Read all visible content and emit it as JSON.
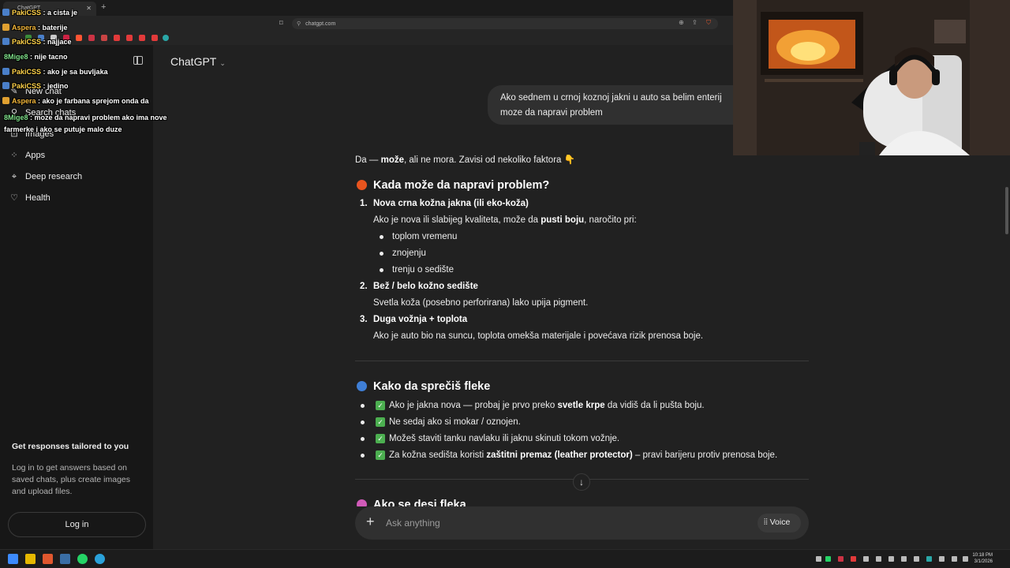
{
  "browser": {
    "tab_title": "ChatGPT",
    "url": "chatgpt.com"
  },
  "sidebar": {
    "items": [
      {
        "label": "New chat",
        "icon": "edit-icon"
      },
      {
        "label": "Search chats",
        "icon": "search-icon"
      },
      {
        "label": "Images",
        "icon": "image-icon"
      },
      {
        "label": "Apps",
        "icon": "apps-icon"
      },
      {
        "label": "Deep research",
        "icon": "telescope-icon"
      },
      {
        "label": "Health",
        "icon": "heart-icon"
      }
    ],
    "promo_title": "Get responses tailored to you",
    "promo_text": "Log in to get answers based on saved chats, plus create images and upload files.",
    "login_label": "Log in"
  },
  "stream_chat": [
    {
      "user": "PakiCSS",
      "message": "a cista je"
    },
    {
      "user": "Aspera",
      "message": "baterije"
    },
    {
      "user": "PakiCSS",
      "message": "najjace"
    },
    {
      "user": "8Mige8",
      "message": "nije tacno"
    },
    {
      "user": "PakiCSS",
      "message": "ako je sa buvljaka"
    },
    {
      "user": "PakiCSS",
      "message": "jedino"
    },
    {
      "user": "Aspera",
      "message": "ako je farbana sprejom onda da"
    },
    {
      "user": "8Mige8",
      "message": "moze da napravi problem ako ima nove farmerke i ako se putuje malo duze"
    }
  ],
  "header": {
    "model_name": "ChatGPT"
  },
  "conversation": {
    "user_message_line1": "Ako sednem u crnoj koznoj jakni u auto sa belim enterij",
    "user_message_line2": "moze da napravi problem",
    "intro_prefix": "Da — ",
    "intro_bold": "može",
    "intro_suffix": ", ali ne mora. Zavisi od nekoliko faktora 👇",
    "section1_title": "Kada može da napravi problem?",
    "item1_num": "1.",
    "item1_title": "Nova crna kožna jakna (ili eko-koža)",
    "item1_text_a": "Ako je nova ili slabijeg kvaliteta, može da ",
    "item1_text_bold": "pusti boju",
    "item1_text_b": ", naročito pri:",
    "item1_bullets": [
      "toplom vremenu",
      "znojenju",
      "trenju o sedište"
    ],
    "item2_num": "2.",
    "item2_title": "Bež / belo kožno sedište",
    "item2_text": "Svetla koža (posebno perforirana) lako upija pigment.",
    "item3_num": "3.",
    "item3_title": "Duga vožnja + toplota",
    "item3_text": "Ako je auto bio na suncu, toplota omekša materijale i povećava rizik prenosa boje.",
    "section2_title": "Kako da sprečiš fleke",
    "tip1_a": "Ako je jakna nova — probaj je prvo preko ",
    "tip1_bold": "svetle krpe",
    "tip1_b": " da vidiš da li pušta boju.",
    "tip2": "Ne sedaj ako si mokar / oznojen.",
    "tip3": "Možeš staviti tanku navlaku ili jaknu skinuti tokom vožnje.",
    "tip4_a": "Za kožna sedišta koristi ",
    "tip4_bold": "zaštitni premaz (leather protector)",
    "tip4_b": " – pravi barijeru protiv prenosa boje.",
    "section3_title": "Ako se desi fleka"
  },
  "composer": {
    "placeholder": "Ask anything",
    "voice_label": "Voice"
  },
  "taskbar": {
    "time": "10:18 PM",
    "date": "3/1/2026"
  },
  "colors": {
    "sidebar_bg": "#171717",
    "main_bg": "#212121",
    "bubble_bg": "#303030",
    "check_green": "#4caf50"
  }
}
